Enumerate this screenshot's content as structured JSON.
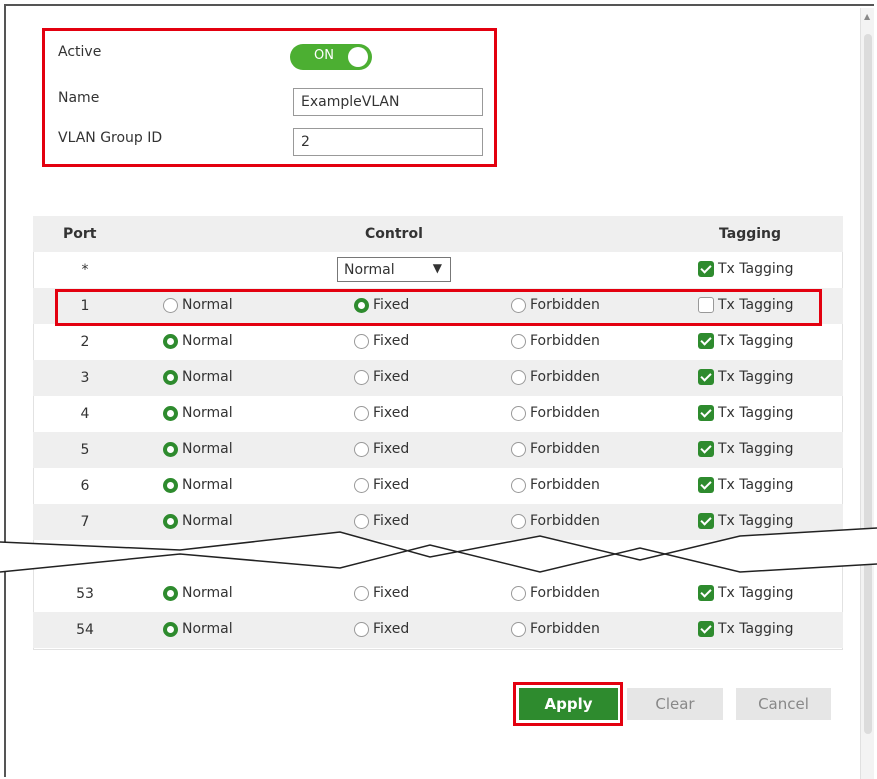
{
  "form": {
    "active_label": "Active",
    "active_toggle": "ON",
    "name_label": "Name",
    "name_value": "ExampleVLAN",
    "vlan_group_id_label": "VLAN Group ID",
    "vlan_group_id_value": "2"
  },
  "table": {
    "headers": {
      "port": "Port",
      "control": "Control",
      "tagging": "Tagging"
    },
    "all_row": {
      "port": "*",
      "control_select": "Normal",
      "tagging": "Tx Tagging",
      "tagging_checked": true
    },
    "options": {
      "normal": "Normal",
      "fixed": "Fixed",
      "forbidden": "Forbidden",
      "tagging": "Tx Tagging"
    },
    "rows": [
      {
        "port": "1",
        "selected": "fixed",
        "tagging_checked": false
      },
      {
        "port": "2",
        "selected": "normal",
        "tagging_checked": true
      },
      {
        "port": "3",
        "selected": "normal",
        "tagging_checked": true
      },
      {
        "port": "4",
        "selected": "normal",
        "tagging_checked": true
      },
      {
        "port": "5",
        "selected": "normal",
        "tagging_checked": true
      },
      {
        "port": "6",
        "selected": "normal",
        "tagging_checked": true
      },
      {
        "port": "7",
        "selected": "normal",
        "tagging_checked": true
      },
      {
        "port": "53",
        "selected": "normal",
        "tagging_checked": true
      },
      {
        "port": "54",
        "selected": "normal",
        "tagging_checked": true
      }
    ]
  },
  "buttons": {
    "apply": "Apply",
    "clear": "Clear",
    "cancel": "Cancel"
  },
  "colors": {
    "accent_green": "#2e8b2e",
    "highlight_red": "#e3000f",
    "row_alt": "#efefef"
  }
}
